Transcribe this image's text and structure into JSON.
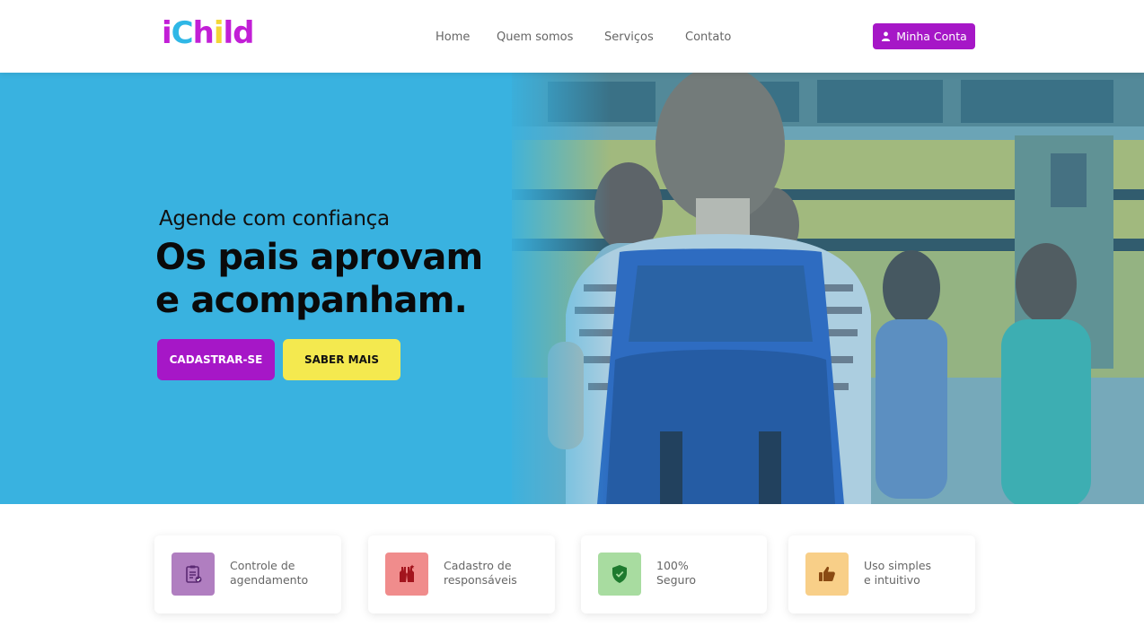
{
  "header": {
    "logo_letters": [
      "i",
      "C",
      "h",
      "i",
      "l",
      "d"
    ],
    "nav": [
      "Home",
      "Quem somos",
      "Serviços",
      "Contato"
    ],
    "account_label": "Minha Conta"
  },
  "hero": {
    "tagline": "Agende com confiança",
    "headline_line1": "Os pais aprovam",
    "headline_line2": "e acompanham.",
    "signup_label": "CADASTRAR-SE",
    "learn_more_label": "SABER MAIS"
  },
  "features": [
    {
      "icon": "clipboard-check-icon",
      "line1": "Controle de",
      "line2": "agendamento",
      "color": "#b07ec0"
    },
    {
      "icon": "raised-hands-icon",
      "line1": "Cadastro de",
      "line2": "responsáveis",
      "color": "#f08c8c"
    },
    {
      "icon": "shield-icon",
      "line1": "100%",
      "line2": "Seguro",
      "color": "#a8dca0"
    },
    {
      "icon": "thumbs-up-icon",
      "line1": "Uso simples",
      "line2": "e intuitivo",
      "color": "#f8cf88"
    }
  ],
  "colors": {
    "brand_purple": "#a617c7",
    "hero_blue": "#39b2e0",
    "cta_yellow": "#f4e94f"
  }
}
